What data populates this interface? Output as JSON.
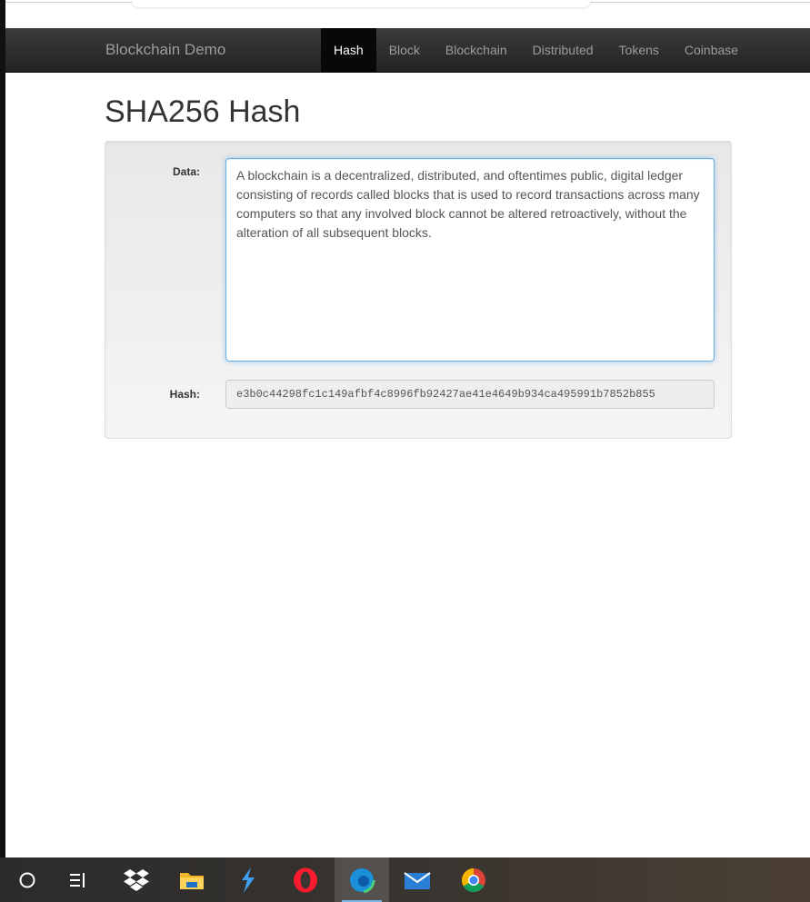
{
  "navbar": {
    "brand": "Blockchain Demo",
    "items": [
      {
        "label": "Hash",
        "active": true
      },
      {
        "label": "Block",
        "active": false
      },
      {
        "label": "Blockchain",
        "active": false
      },
      {
        "label": "Distributed",
        "active": false
      },
      {
        "label": "Tokens",
        "active": false
      },
      {
        "label": "Coinbase",
        "active": false
      }
    ]
  },
  "page": {
    "title": "SHA256 Hash"
  },
  "form": {
    "data_label": "Data:",
    "data_value": "A blockchain is a decentralized, distributed, and oftentimes public, digital ledger consisting of records called blocks that is used to record transactions across many computers so that any involved block cannot be altered retroactively, without the alteration of all subsequent blocks.",
    "hash_label": "Hash:",
    "hash_value": "e3b0c44298fc1c149afbf4c8996fb92427ae41e4649b934ca495991b7852b855"
  },
  "taskbar": {
    "icons": [
      {
        "name": "cortana-search-icon",
        "active": false
      },
      {
        "name": "task-view-icon",
        "active": false
      },
      {
        "name": "dropbox-icon",
        "active": false
      },
      {
        "name": "file-explorer-icon",
        "active": false
      },
      {
        "name": "visual-studio-code-icon",
        "active": false
      },
      {
        "name": "opera-icon",
        "active": false
      },
      {
        "name": "edge-icon",
        "active": true
      },
      {
        "name": "mail-icon",
        "active": false
      },
      {
        "name": "chrome-icon",
        "active": false
      }
    ]
  },
  "colors": {
    "navbar_bg": "#222222",
    "nav_active_bg": "#080808",
    "nav_text": "#9d9d9d",
    "focus_border": "#66afe9",
    "taskbar_bg": "#2b2b2b"
  }
}
